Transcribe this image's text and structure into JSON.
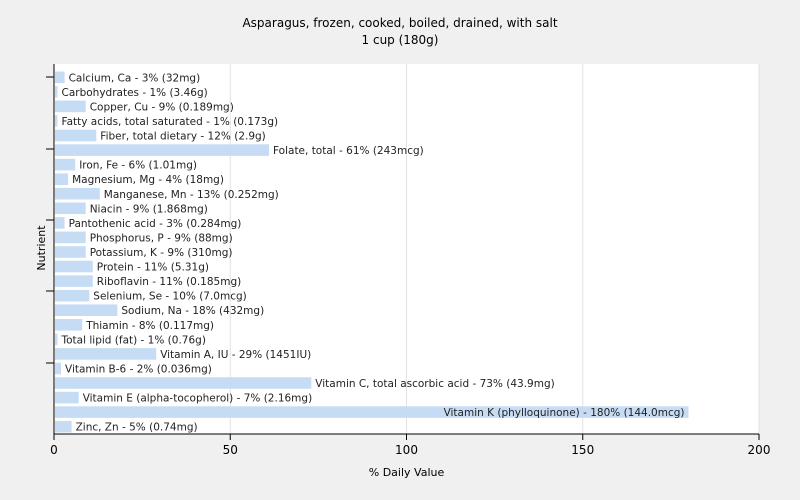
{
  "chart_data": {
    "type": "bar",
    "orientation": "horizontal",
    "title": "Asparagus, frozen, cooked, boiled, drained, with salt",
    "subtitle": "1 cup (180g)",
    "xlabel": "% Daily Value",
    "ylabel": "Nutrient",
    "xlim": [
      0,
      200
    ],
    "xticks": [
      0,
      50,
      100,
      150,
      200
    ],
    "grid": true,
    "bar_color": "#c6dcf5",
    "categories": [
      "Calcium, Ca",
      "Carbohydrates",
      "Copper, Cu",
      "Fatty acids, total saturated",
      "Fiber, total dietary",
      "Folate, total",
      "Iron, Fe",
      "Magnesium, Mg",
      "Manganese, Mn",
      "Niacin",
      "Pantothenic acid",
      "Phosphorus, P",
      "Potassium, K",
      "Protein",
      "Riboflavin",
      "Selenium, Se",
      "Sodium, Na",
      "Thiamin",
      "Total lipid (fat)",
      "Vitamin A, IU",
      "Vitamin B-6",
      "Vitamin C, total ascorbic acid",
      "Vitamin E (alpha-tocopherol)",
      "Vitamin K (phylloquinone)",
      "Zinc, Zn"
    ],
    "values": [
      3,
      1,
      9,
      1,
      12,
      61,
      6,
      4,
      13,
      9,
      3,
      9,
      9,
      11,
      11,
      10,
      18,
      8,
      1,
      29,
      2,
      73,
      7,
      180,
      5
    ],
    "labels": [
      "Calcium, Ca - 3% (32mg)",
      "Carbohydrates - 1% (3.46g)",
      "Copper, Cu - 9% (0.189mg)",
      "Fatty acids, total saturated - 1% (0.173g)",
      "Fiber, total dietary - 12% (2.9g)",
      "Folate, total - 61% (243mcg)",
      "Iron, Fe - 6% (1.01mg)",
      "Magnesium, Mg - 4% (18mg)",
      "Manganese, Mn - 13% (0.252mg)",
      "Niacin - 9% (1.868mg)",
      "Pantothenic acid - 3% (0.284mg)",
      "Phosphorus, P - 9% (88mg)",
      "Potassium, K - 9% (310mg)",
      "Protein - 11% (5.31g)",
      "Riboflavin - 11% (0.185mg)",
      "Selenium, Se - 10% (7.0mcg)",
      "Sodium, Na - 18% (432mg)",
      "Thiamin - 8% (0.117mg)",
      "Total lipid (fat) - 1% (0.76g)",
      "Vitamin A, IU - 29% (1451IU)",
      "Vitamin B-6 - 2% (0.036mg)",
      "Vitamin C, total ascorbic acid - 73% (43.9mg)",
      "Vitamin E (alpha-tocopherol) - 7% (2.16mg)",
      "Vitamin K (phylloquinone) - 180% (144.0mcg)",
      "Zinc, Zn - 5% (0.74mg)"
    ]
  }
}
